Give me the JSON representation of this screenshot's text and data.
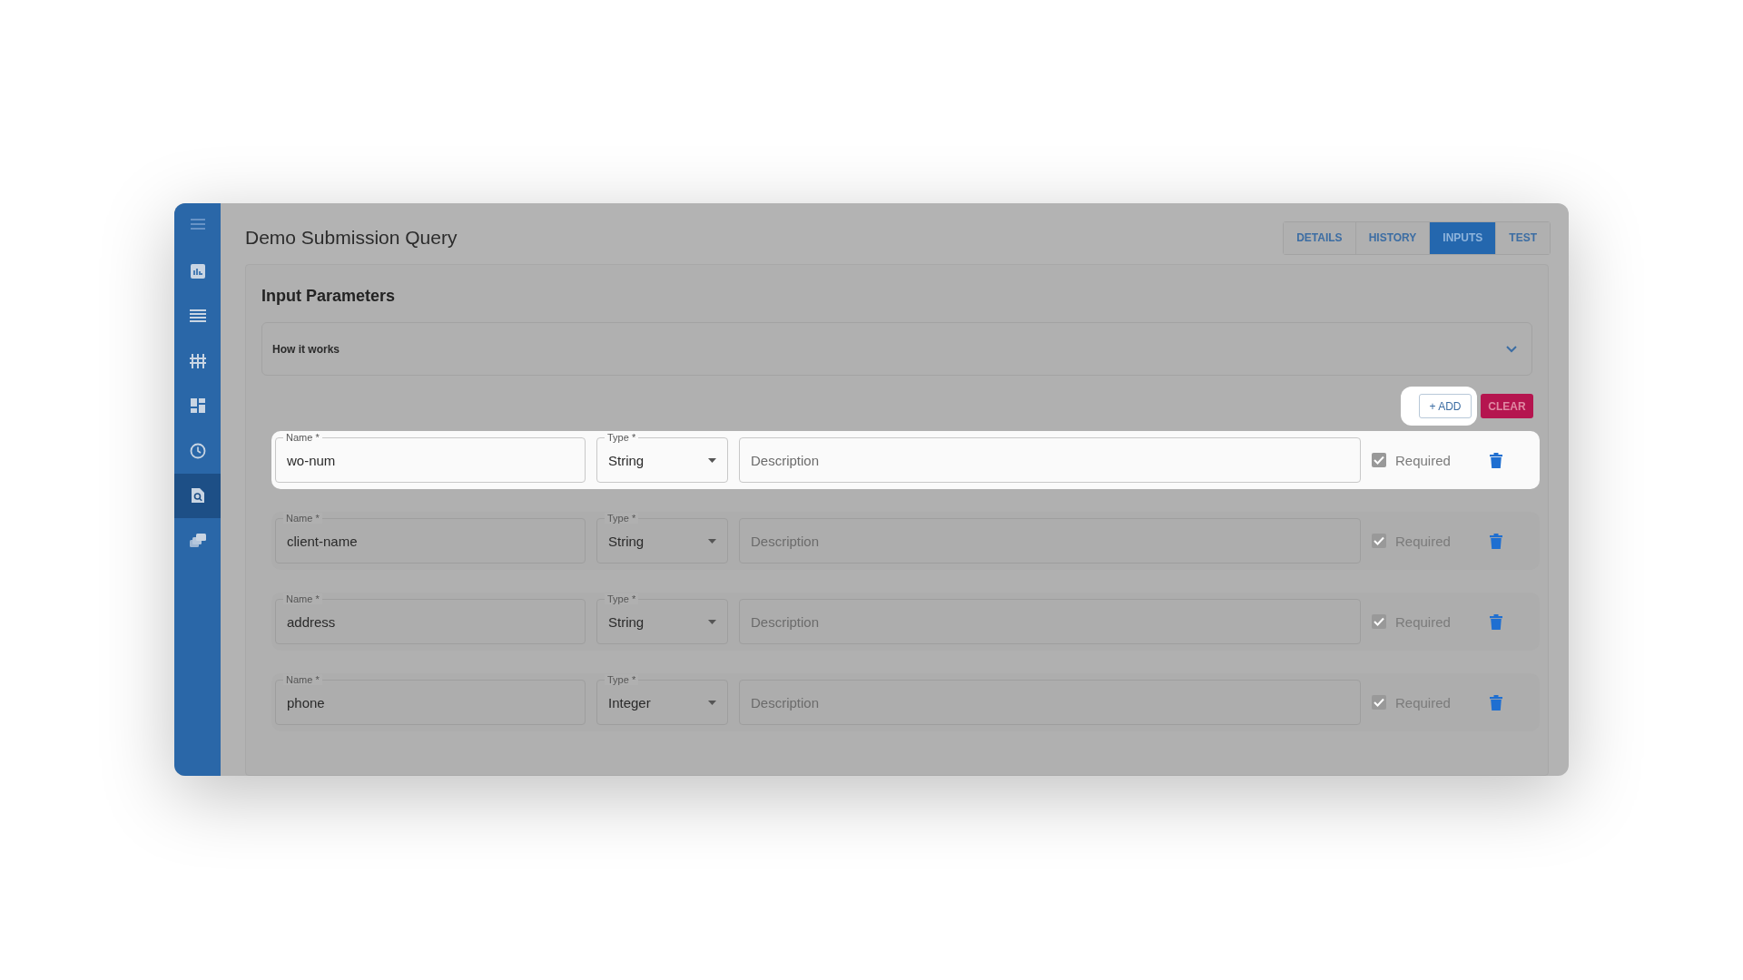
{
  "sidebar": {
    "items": [
      {
        "kind": "menu",
        "selected": false
      },
      {
        "kind": "chart",
        "selected": false
      },
      {
        "kind": "list",
        "selected": false
      },
      {
        "kind": "sliders",
        "selected": false
      },
      {
        "kind": "dashboard",
        "selected": false
      },
      {
        "kind": "clock",
        "selected": false
      },
      {
        "kind": "search-doc",
        "selected": true
      },
      {
        "kind": "stack",
        "selected": false
      }
    ]
  },
  "title": "Demo Submission Query",
  "tabs": [
    {
      "label": "DETAILS",
      "selected": false
    },
    {
      "label": "HISTORY",
      "selected": false
    },
    {
      "label": "INPUTS",
      "selected": true
    },
    {
      "label": "TEST",
      "selected": false
    }
  ],
  "section_title": "Input Parameters",
  "accordion": {
    "label": "How it works",
    "expanded": false
  },
  "add_button": {
    "label": "+ ADD",
    "highlighted": true
  },
  "clear_button": {
    "label": "CLEAR"
  },
  "parameters": [
    {
      "name_label": "Name *",
      "name": "wo-num",
      "type_label": "Type *",
      "type": "String",
      "description_placeholder": "Description",
      "required_label": "Required",
      "required": true,
      "highlighted": true
    },
    {
      "name_label": "Name *",
      "name": "client-name",
      "type_label": "Type *",
      "type": "String",
      "description_placeholder": "Description",
      "required_label": "Required",
      "required": true,
      "highlighted": false
    },
    {
      "name_label": "Name *",
      "name": "address",
      "type_label": "Type *",
      "type": "String",
      "description_placeholder": "Description",
      "required_label": "Required",
      "required": true,
      "highlighted": false
    },
    {
      "name_label": "Name *",
      "name": "phone",
      "type_label": "Type *",
      "type": "Integer",
      "description_placeholder": "Description",
      "required_label": "Required",
      "required": true,
      "highlighted": false
    }
  ]
}
